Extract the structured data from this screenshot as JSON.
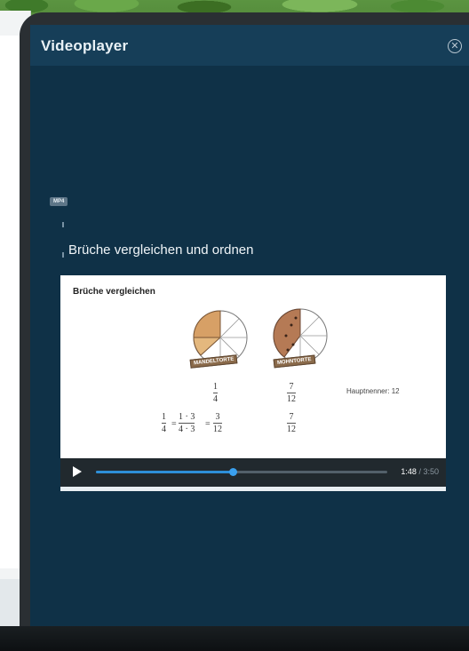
{
  "player": {
    "title": "Videoplayer",
    "close_icon": "close-circle-icon",
    "badge": "MP4",
    "video_title": "Brüche vergleichen und ordnen"
  },
  "slide": {
    "heading": "Brüche vergleichen",
    "pie_left_label": "MANDELTORTE",
    "pie_right_label": "MOHNTORTE",
    "frac_left_num": "1",
    "frac_left_den": "4",
    "frac_right_num": "7",
    "frac_right_den": "12",
    "expand_a_num": "1",
    "expand_a_den": "4",
    "expand_b_num": "1 · 3",
    "expand_b_den": "4 · 3",
    "expand_c_num": "3",
    "expand_c_den": "12",
    "expand_eq": "=",
    "expand_eq2": "=",
    "frac_right2_num": "7",
    "frac_right2_den": "12",
    "hauptnenner": "Hauptnenner: 12"
  },
  "controls": {
    "play_icon": "play-icon",
    "progress": 0.47,
    "current_time": "1:48",
    "separator": " / ",
    "duration": "3:50"
  },
  "colors": {
    "screen_bg": "#0f3147",
    "title_bar_bg": "#163e58",
    "progress_fill": "#2d8fd8"
  }
}
